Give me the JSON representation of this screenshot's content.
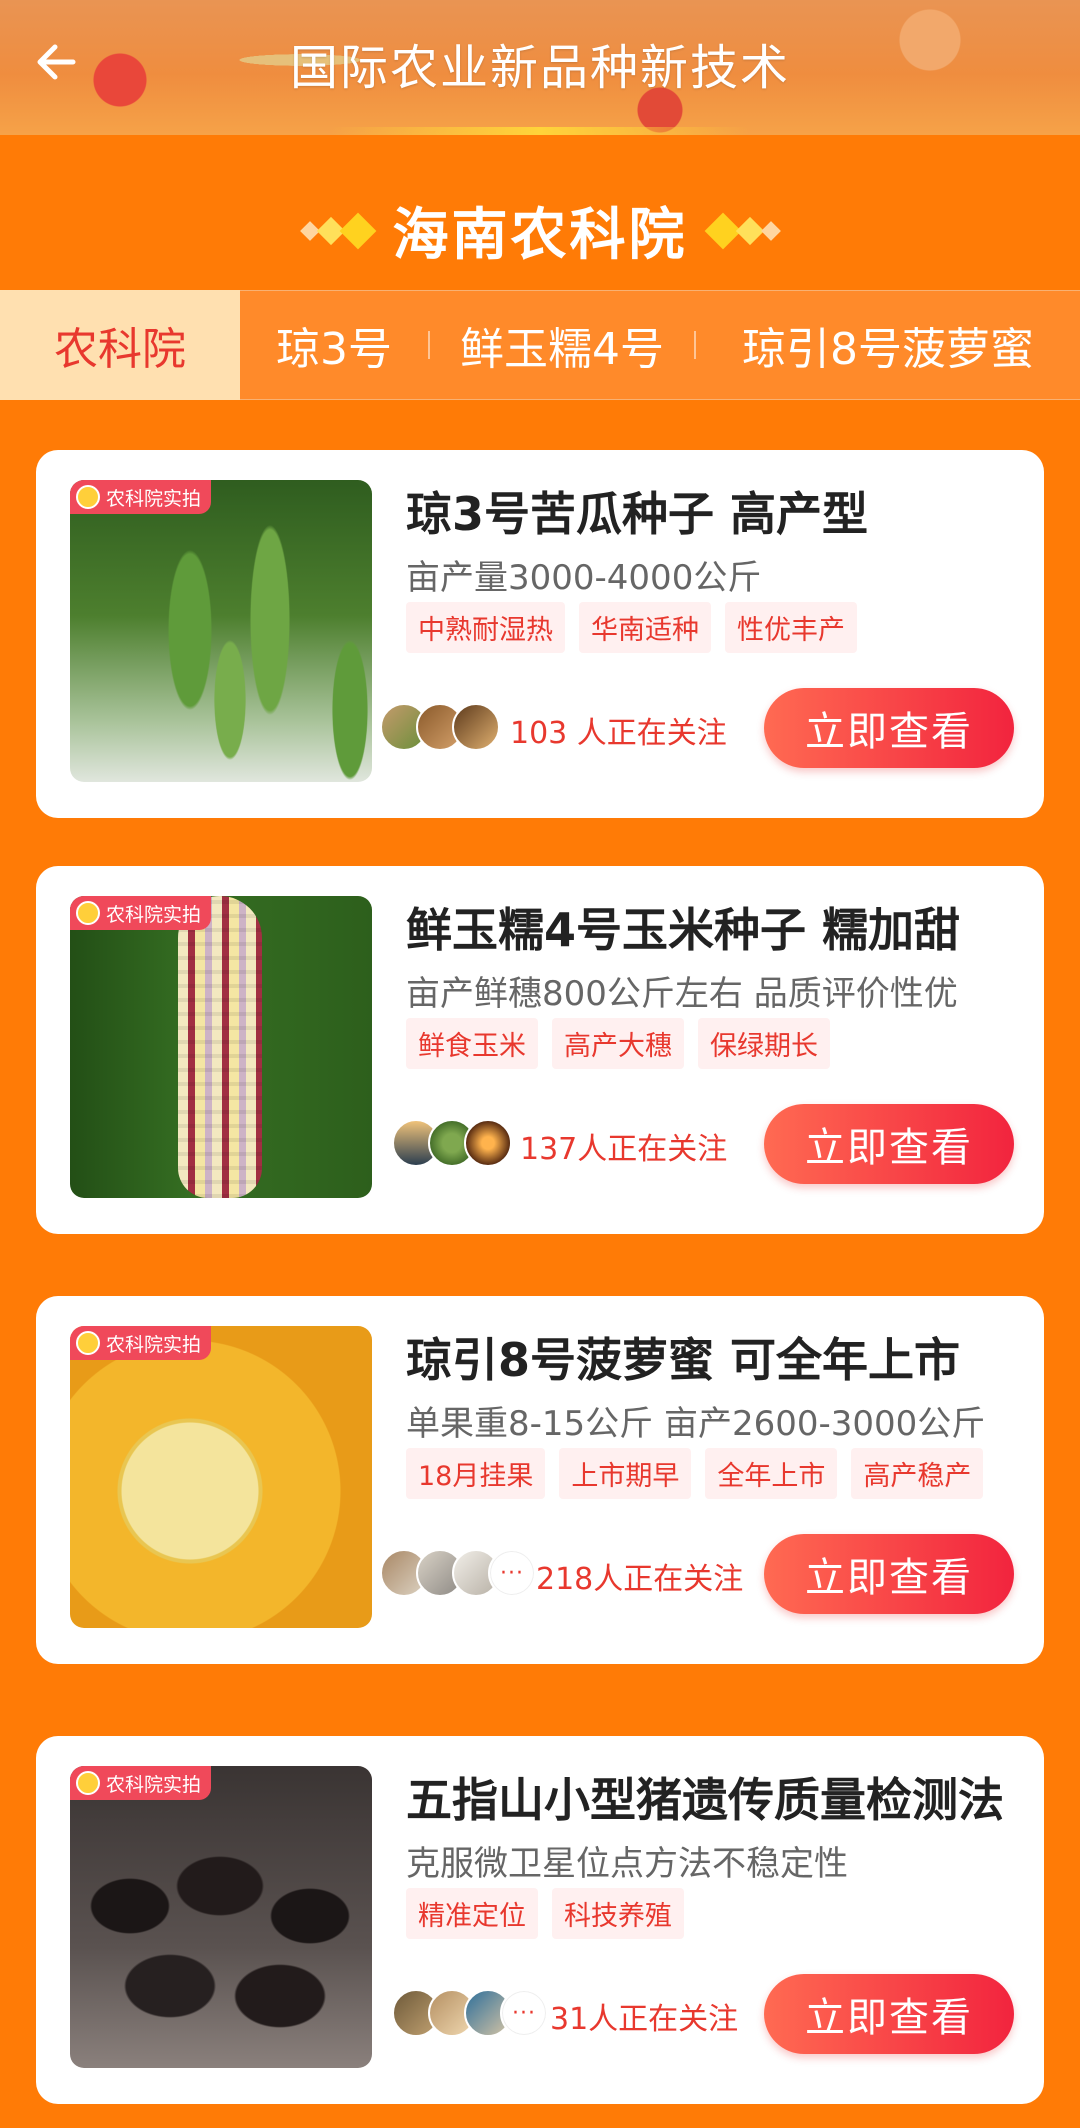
{
  "header": {
    "title": "国际农业新品种新技术"
  },
  "section": {
    "title": "海南农科院"
  },
  "tabs": [
    {
      "label": "农科院",
      "active": true
    },
    {
      "label": "琼3号",
      "active": false
    },
    {
      "label": "鲜玉糯4号",
      "active": false
    },
    {
      "label": "琼引8号菠萝蜜",
      "active": false
    }
  ],
  "products": [
    {
      "badge": "农科院实拍",
      "title": "琼3号苦瓜种子 高产型",
      "subtitle": "亩产量3000-4000公斤",
      "tags": [
        "中熟耐湿热",
        "华南适种",
        "性优丰产"
      ],
      "followers": "103 人正在关注",
      "cta": "立即查看"
    },
    {
      "badge": "农科院实拍",
      "title": "鲜玉糯4号玉米种子 糯加甜",
      "subtitle": "亩产鲜穗800公斤左右 品质评价性优",
      "tags": [
        "鲜食玉米",
        "高产大穗",
        "保绿期长"
      ],
      "followers": "137人正在关注",
      "cta": "立即查看"
    },
    {
      "badge": "农科院实拍",
      "title": "琼引8号菠萝蜜 可全年上市",
      "subtitle": "单果重8-15公斤 亩产2600-3000公斤",
      "tags": [
        "18月挂果",
        "上市期早",
        "全年上市",
        "高产稳产"
      ],
      "followers": "218人正在关注",
      "cta": "立即查看"
    },
    {
      "badge": "农科院实拍",
      "title": "五指山小型猪遗传质量检测法",
      "subtitle": "克服微卫星位点方法不稳定性",
      "tags": [
        "精准定位",
        "科技养殖"
      ],
      "followers": "31人正在关注",
      "cta": "立即查看"
    }
  ],
  "colors": {
    "background": "#ff7b06",
    "accent": "#e8382e",
    "cta": "#f2243e"
  },
  "icons": {
    "back": "arrow-left-icon"
  }
}
